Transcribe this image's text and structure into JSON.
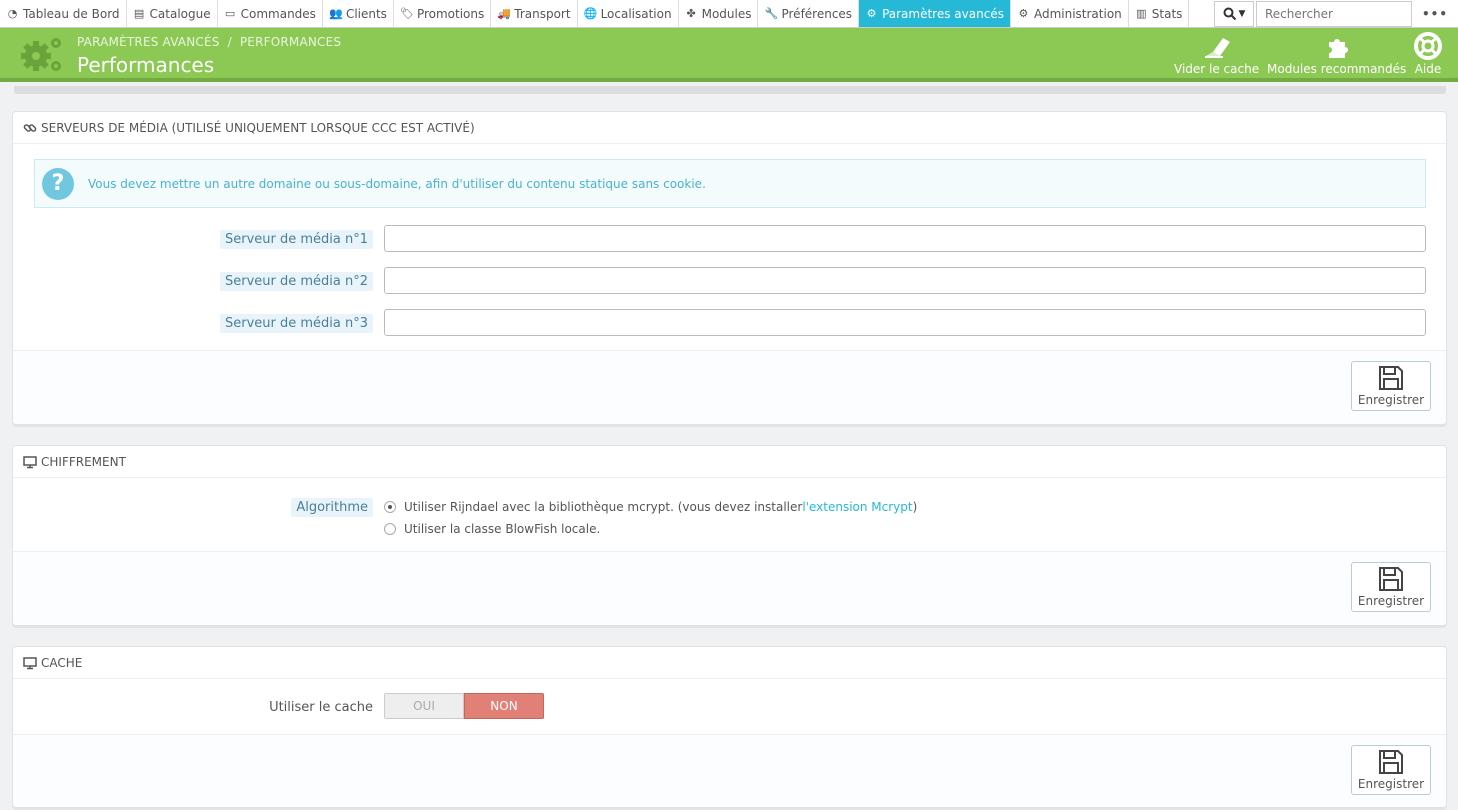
{
  "nav": {
    "items": [
      {
        "label": "Tableau de Bord",
        "icon": "dashboard-icon"
      },
      {
        "label": "Catalogue",
        "icon": "book-icon"
      },
      {
        "label": "Commandes",
        "icon": "credit-card-icon"
      },
      {
        "label": "Clients",
        "icon": "users-icon"
      },
      {
        "label": "Promotions",
        "icon": "tags-icon"
      },
      {
        "label": "Transport",
        "icon": "truck-icon"
      },
      {
        "label": "Localisation",
        "icon": "globe-icon"
      },
      {
        "label": "Modules",
        "icon": "puzzle-icon"
      },
      {
        "label": "Préférences",
        "icon": "wrench-icon"
      },
      {
        "label": "Paramètres avancés",
        "icon": "cogs-icon"
      },
      {
        "label": "Administration",
        "icon": "cog-icon"
      },
      {
        "label": "Stats",
        "icon": "bar-chart-icon"
      }
    ],
    "active_index": 9,
    "search_placeholder": "Rechercher",
    "more_label": "•••",
    "accent": "#25b9d7"
  },
  "header": {
    "breadcrumb": [
      "PARAMÈTRES AVANCÉS",
      "PERFORMANCES"
    ],
    "title": "Performances",
    "buttons": {
      "clear_cache": "Vider le cache",
      "recommended": "Modules recommandés",
      "help": "Aide"
    },
    "color": "#8bc954"
  },
  "media": {
    "title": "SERVEURS DE MÉDIA (UTILISÉ UNIQUEMENT LORSQUE CCC EST ACTIVÉ)",
    "alert": "Vous devez mettre un autre domaine ou sous-domaine, afin d'utiliser du contenu statique sans cookie.",
    "fields": [
      {
        "label": "Serveur de média n°1",
        "value": ""
      },
      {
        "label": "Serveur de média n°2",
        "value": ""
      },
      {
        "label": "Serveur de média n°3",
        "value": ""
      }
    ],
    "save": "Enregistrer"
  },
  "cipher": {
    "title": "CHIFFREMENT",
    "label": "Algorithme",
    "option1_text": "Utiliser Rijndael avec la bibliothèque mcrypt. (vous devez installer ",
    "option1_link": "l'extension Mcrypt",
    "option1_end": ")",
    "option2": "Utiliser la classe BlowFish locale.",
    "selected": 1,
    "save": "Enregistrer"
  },
  "cache": {
    "title": "CACHE",
    "label": "Utiliser le cache",
    "yes": "OUI",
    "no": "NON",
    "value": "NON",
    "save": "Enregistrer"
  }
}
